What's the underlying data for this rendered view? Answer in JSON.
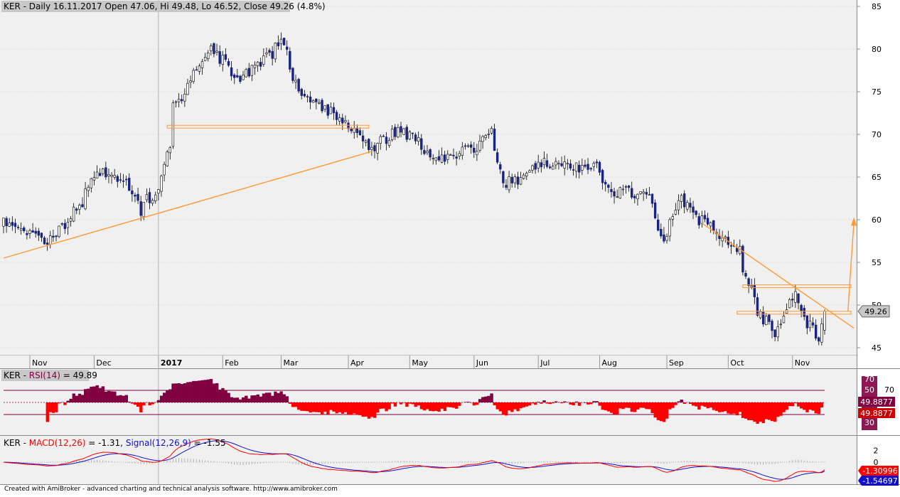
{
  "price_title": {
    "symbol": "KER",
    "text": " - Daily 16.11.2017 Open 47.06, Hi 49.48, Lo 46.52, Close 49.26 (4.8%)"
  },
  "rsi_title": {
    "symbol": "KER",
    "label": "RSI(14)",
    "value_text": " = 49.89"
  },
  "macd_title": {
    "symbol": "KER",
    "macd_label": "MACD(12,26)",
    "macd_value": " = -1.31, ",
    "signal_label": "Signal(12,26,9)",
    "signal_value": " = -1.55"
  },
  "footer": "Created with AmiBroker - advanced charting and technical analysis software. http://www.amibroker.com",
  "colors": {
    "background": "#f0f0f0",
    "up_body": "#ffffff",
    "down_body": "#1a237e",
    "trendline": "#ff9933",
    "rsi_fill": "#800040",
    "rsi_fill_neg": "#ff0000",
    "macd": "#ff0000",
    "signal": "#1010cc"
  },
  "chart_data": [
    {
      "type": "candlestick",
      "title": "KER - Daily 16.11.2017 Open 47.06, Hi 49.48, Lo 46.52, Close 49.26 (4.8%)",
      "x_tick_labels": [
        "Nov",
        "Dec",
        "2017",
        "Feb",
        "Mar",
        "Apr",
        "May",
        "Jun",
        "Jul",
        "Aug",
        "Sep",
        "Oct",
        "Nov"
      ],
      "y_ticks": [
        45,
        50,
        55,
        60,
        65,
        70,
        75,
        80,
        85
      ],
      "ylim": [
        44,
        85.5
      ],
      "last_close_label": "49.26",
      "last_bar": {
        "date": "16.11.2017",
        "open": 47.06,
        "high": 49.48,
        "low": 46.52,
        "close": 49.26
      },
      "close_path": [
        {
          "date": "2016-10-24",
          "close": 59.5
        },
        {
          "date": "2016-11-10",
          "close": 57.5
        },
        {
          "date": "2016-11-25",
          "close": 61.8
        },
        {
          "date": "2016-12-02",
          "close": 65.5
        },
        {
          "date": "2016-12-16",
          "close": 65.0
        },
        {
          "date": "2016-12-23",
          "close": 61.0
        },
        {
          "date": "2017-01-03",
          "close": 64.5
        },
        {
          "date": "2017-01-09",
          "close": 73.0
        },
        {
          "date": "2017-01-20",
          "close": 78.0
        },
        {
          "date": "2017-01-27",
          "close": 80.0
        },
        {
          "date": "2017-02-10",
          "close": 76.5
        },
        {
          "date": "2017-03-01",
          "close": 80.5
        },
        {
          "date": "2017-03-10",
          "close": 75.0
        },
        {
          "date": "2017-03-31",
          "close": 71.5
        },
        {
          "date": "2017-04-13",
          "close": 68.5
        },
        {
          "date": "2017-04-28",
          "close": 70.5
        },
        {
          "date": "2017-05-15",
          "close": 67.0
        },
        {
          "date": "2017-06-02",
          "close": 68.5
        },
        {
          "date": "2017-06-09",
          "close": 70.5
        },
        {
          "date": "2017-06-16",
          "close": 64.0
        },
        {
          "date": "2017-07-05",
          "close": 66.5
        },
        {
          "date": "2017-07-31",
          "close": 66.0
        },
        {
          "date": "2017-08-04",
          "close": 63.5
        },
        {
          "date": "2017-08-24",
          "close": 63.0
        },
        {
          "date": "2017-08-31",
          "close": 58.0
        },
        {
          "date": "2017-09-08",
          "close": 62.5
        },
        {
          "date": "2017-09-22",
          "close": 59.0
        },
        {
          "date": "2017-10-06",
          "close": 56.5
        },
        {
          "date": "2017-10-16",
          "close": 49.0
        },
        {
          "date": "2017-10-24",
          "close": 46.5
        },
        {
          "date": "2017-11-02",
          "close": 51.5
        },
        {
          "date": "2017-11-08",
          "close": 48.0
        },
        {
          "date": "2017-11-14",
          "close": 45.8
        },
        {
          "date": "2017-11-16",
          "close": 49.26
        }
      ],
      "annotations": [
        {
          "kind": "trendline",
          "from": {
            "date": "2016-10-19",
            "price": 55.5
          },
          "to": {
            "date": "2017-04-13",
            "price": 68.0
          }
        },
        {
          "kind": "horizontal",
          "from_date": "2017-01-05",
          "to_date": "2017-04-12",
          "price": 70.9
        },
        {
          "kind": "trendline",
          "from": {
            "date": "2017-09-19",
            "price": 59.6
          },
          "to": {
            "date": "2017-11-30",
            "price": 47.3
          }
        },
        {
          "kind": "horizontal",
          "from_date": "2017-10-09",
          "to_date": "2017-11-28",
          "price": 52.2
        },
        {
          "kind": "horizontal",
          "from_date": "2017-10-05",
          "to_date": "2017-11-28",
          "price": 49.1
        },
        {
          "kind": "arrow",
          "from": {
            "date": "2017-11-27",
            "price": 52.2
          },
          "to": {
            "date": "2017-11-30",
            "price": 60.3
          }
        }
      ]
    },
    {
      "type": "area",
      "title": "KER - RSI(14) = 49.89",
      "y_ticks": [
        30,
        50,
        70
      ],
      "levels": [
        30,
        70
      ],
      "last_value": 49.89,
      "value_label": "49.8877",
      "ylim": [
        22,
        78
      ]
    },
    {
      "type": "line",
      "title": "KER - MACD(12,26) = -1.31, Signal(12,26,9) = -1.55",
      "y_ticks": [
        0,
        2
      ],
      "series": [
        {
          "name": "MACD(12,26)",
          "last_value": -1.31
        },
        {
          "name": "Signal(12,26,9)",
          "last_value": -1.55
        }
      ],
      "value_labels": [
        "-1.30996",
        "-1.54697"
      ],
      "ylim": [
        -3.3,
        3.0
      ]
    }
  ]
}
